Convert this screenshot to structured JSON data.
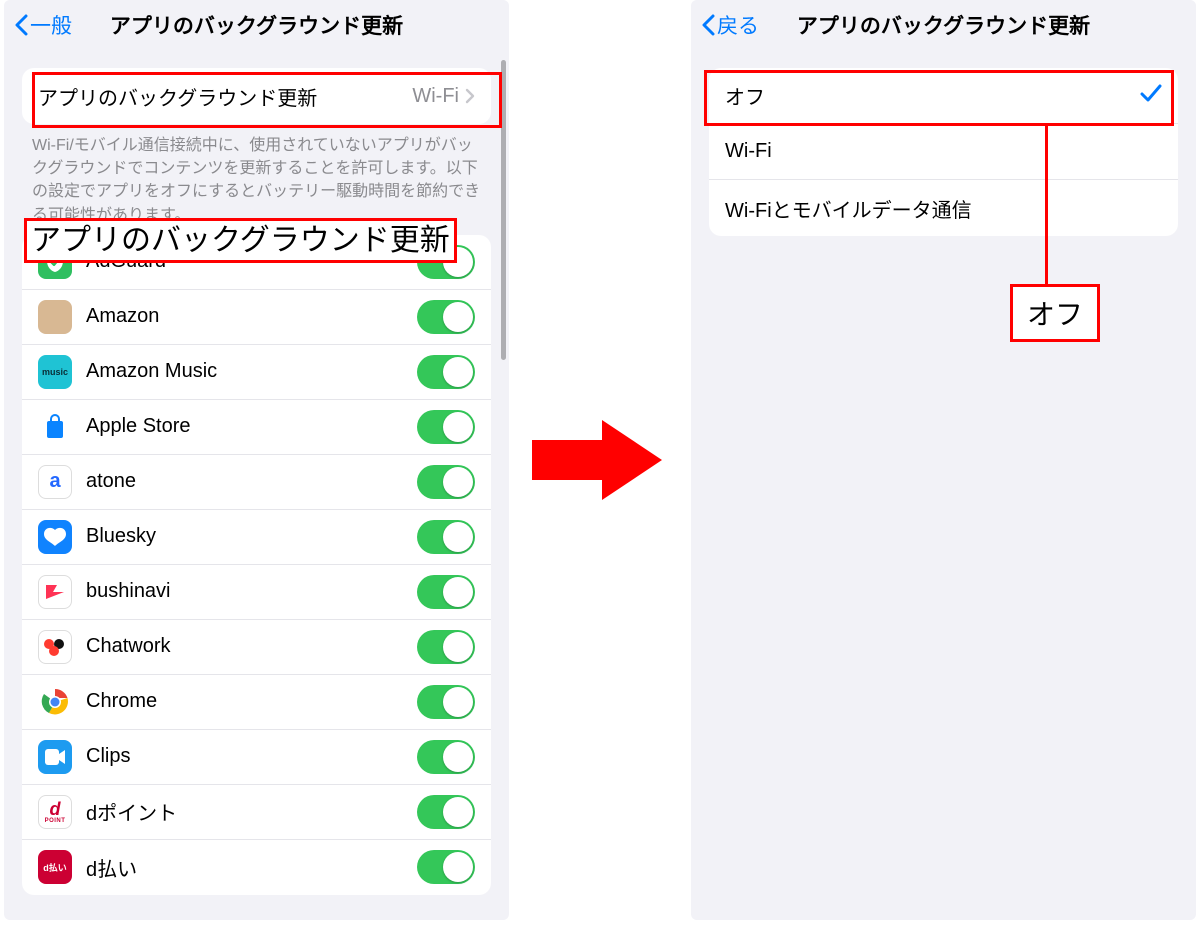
{
  "left": {
    "back_label": "一般",
    "title": "アプリのバックグラウンド更新",
    "setting_row": {
      "label": "アプリのバックグラウンド更新",
      "value": "Wi-Fi"
    },
    "footer": "Wi-Fi/モバイル通信接続中に、使用されていないアプリがバックグラウンドでコンテンツを更新することを許可します。以下の設定でアプリをオフにするとバッテリー駆動時間を節約できる可能性があります。",
    "caption": "アプリのバックグラウンド更新",
    "apps": [
      {
        "name": "AdGuard",
        "icon_bg": "#2fbf60",
        "icon_text": "",
        "shield": true
      },
      {
        "name": "Amazon",
        "icon_bg": "#d8b893",
        "icon_text": ""
      },
      {
        "name": "Amazon Music",
        "icon_bg": "#1fc3d4",
        "icon_text": "music",
        "icon_color": "#0a2e36"
      },
      {
        "name": "Apple Store",
        "icon_bg": "#ffffff",
        "icon_text": "",
        "apple_bag": true
      },
      {
        "name": "atone",
        "icon_bg": "#ffffff",
        "icon_text": "a",
        "icon_color": "#2468ff",
        "border": true
      },
      {
        "name": "Bluesky",
        "icon_bg": "#1083fe",
        "icon_text": "",
        "butterfly": true
      },
      {
        "name": "bushinavi",
        "icon_bg": "#ffffff",
        "icon_text": "",
        "bushi": true,
        "border": true
      },
      {
        "name": "Chatwork",
        "icon_bg": "#ffffff",
        "icon_text": "",
        "chatwork": true,
        "border": true
      },
      {
        "name": "Chrome",
        "icon_bg": "#ffffff",
        "icon_text": "",
        "chrome": true
      },
      {
        "name": "Clips",
        "icon_bg": "#1d9bf0",
        "icon_text": "",
        "clips": true
      },
      {
        "name": "dポイント",
        "icon_bg": "#ffffff",
        "icon_text": "d",
        "icon_color": "#cc0033",
        "border": true,
        "sub": "POINT"
      },
      {
        "name": "d払い",
        "icon_bg": "#cc0033",
        "icon_text": "d払い",
        "icon_color": "#ffffff"
      }
    ]
  },
  "right": {
    "back_label": "戻る",
    "title": "アプリのバックグラウンド更新",
    "options": [
      {
        "label": "オフ",
        "selected": true
      },
      {
        "label": "Wi-Fi",
        "selected": false
      },
      {
        "label": "Wi-Fiとモバイルデータ通信",
        "selected": false
      }
    ],
    "callout": "オフ"
  }
}
